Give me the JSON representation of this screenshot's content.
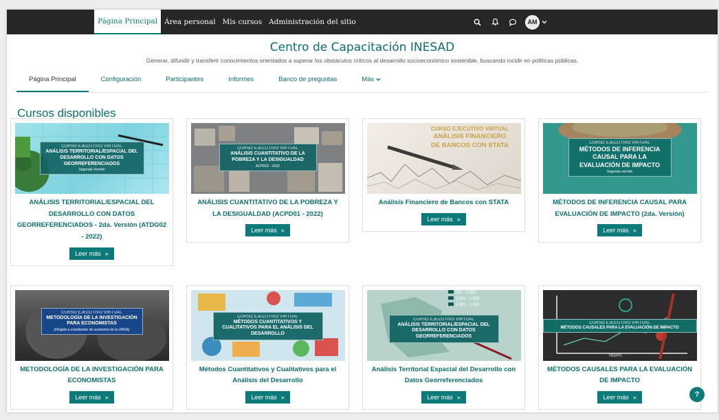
{
  "navbar": {
    "links": [
      {
        "label": "Página Principal"
      },
      {
        "label": "Área personal"
      },
      {
        "label": "Mis cursos"
      },
      {
        "label": "Administración del sitio"
      }
    ],
    "avatar_initials": "AM",
    "icons": [
      "search-icon",
      "bell-icon",
      "chat-icon",
      "chevron-down-icon"
    ]
  },
  "header": {
    "title": "Centro de Capacitación INESAD",
    "subtitle": "Generar, difundir y transferir conocimientos orientados a superar los obstáculos críticos al desarrollo socioeconómico sostenible, buscando incidir en políticas públicas."
  },
  "tabs": [
    {
      "label": "Página Principal"
    },
    {
      "label": "Configuración"
    },
    {
      "label": "Participantes"
    },
    {
      "label": "Informes"
    },
    {
      "label": "Banco de preguntas"
    },
    {
      "label": "Más"
    }
  ],
  "section_title": "Cursos disponibles",
  "read_more_label": "Leer más",
  "courses": [
    {
      "title": "ANÁLISIS TERRITORIAL/ESPACIAL DEL DESARROLLO CON DATOS GEORREFERENCIADOS - 2da. Versión (ATDG02 - 2022)",
      "banner": {
        "top": "CURSO EJECUTIVO VIRTUAL",
        "main": "ANÁLISIS TERRITORIAL/ESPACIAL DEL DESARROLLO CON DATOS GEORREFERENCIADOS",
        "sub": "Segunda Versión"
      }
    },
    {
      "title": "ANÁLISIS CUANTITATIVO DE LA POBREZA Y LA DESIGUALDAD (ACPD01 - 2022)",
      "banner": {
        "top": "CURSO EJECUTIVO VIRTUAL",
        "main": "ANÁLISIS CUANTITATIVO DE LA POBREZA Y LA DESIGUALDAD",
        "sub": "ACPD01 - 2022"
      }
    },
    {
      "title": "Análisis Financiero de Bancos con STATA",
      "banner": {
        "top": "CURSO EJECUTIVO VIRTUAL",
        "main": "ANÁLISIS FINANCIERO DE BANCOS CON STATA",
        "sub": ""
      }
    },
    {
      "title": "MÉTODOS DE INFERENCIA CAUSAL PARA EVALUACIÓN DE IMPACTO (2da. Versión)",
      "banner": {
        "top": "CURSO EJECUTIVO VIRTUAL",
        "main": "MÉTODOS DE INFERENCIA CAUSAL PARA LA EVALUACIÓN DE IMPACTO",
        "sub": "Segunda versión"
      }
    },
    {
      "title": "METODOLOGÍA DE LA INVESTIGACIÓN PARA ECONOMISTAS",
      "banner": {
        "top": "CURSO EJECUTIVO VIRTUAL",
        "main": "METODOLOGÍA DE LA INVESTIGACIÓN PARA ECONOMISTAS",
        "sub": "(Dirigido a estudiantes de economía de la UMSA)"
      }
    },
    {
      "title": "Métodos Cuantitativos y Cualitativos para el Análisis del Desarrollo",
      "banner": {
        "top": "CURSO EJECUTIVO VIRTUAL",
        "main": "MÉTODOS CUANTITATIVOS Y CUALITATIVOS PARA EL ANÁLISIS DEL DESARROLLO",
        "sub": ""
      }
    },
    {
      "title": "Análisis Territorial Espacial del Desarrollo con Datos Georreferenciados",
      "banner": {
        "top": "CURSO EJECUTIVO VIRTUAL",
        "main": "ANÁLISIS TERRITORIAL/ESPACIAL DEL DESARROLLO CON DATOS GEORREFERENCIADOS",
        "sub": ""
      },
      "legend": [
        "501 - 1.000",
        "1.001 - 1.500",
        "1.501 - 2.000"
      ]
    },
    {
      "title": "MÉTODOS CAUSALES PARA LA EVALUACIÓN DE IMPACTO",
      "banner": {
        "top": "CURSO EJECUTIVO VIRTUAL",
        "main": "MÉTODOS CAUSALES PARA LA EVALUACIÓN DE IMPACTO",
        "sub": ""
      },
      "axis_label": "TIEMPO"
    }
  ],
  "help_label": "?",
  "colors": {
    "accent": "#0b7a78",
    "navbar": "#262626",
    "title": "#0b6e6e"
  }
}
